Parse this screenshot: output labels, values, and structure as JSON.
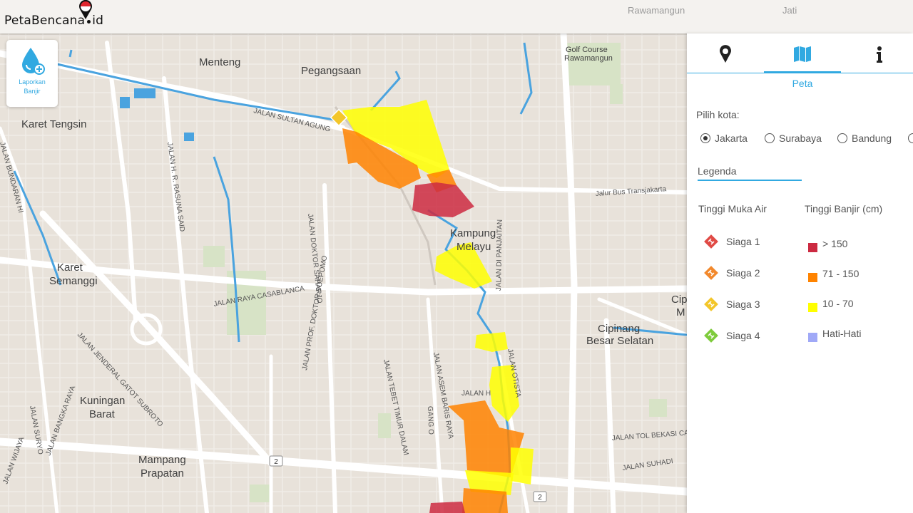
{
  "header": {
    "brand": "PetaBencana",
    "brand_suffix": "id",
    "map_labels_top": [
      "Rawamangun",
      "Jati"
    ]
  },
  "report_button": {
    "line1": "Laporkan",
    "line2": "Banjir",
    "icon": "water-drop-plus-icon"
  },
  "map": {
    "place_labels": [
      "Menteng",
      "Pegangsaan",
      "Karet Tengsin",
      "Karet",
      "Semanggi",
      "Kampung",
      "Melayu",
      "Kuningan",
      "Barat",
      "Mampang",
      "Prapatan",
      "Cipinang",
      "Besar Selatan",
      "Golf Course",
      "Rawamangun",
      "Cip",
      "M"
    ],
    "road_labels": [
      "JALAN SULTAN AGUNG",
      "JALAN H. R. RASUNA SAID",
      "JALAN DOKTOR SAHARJO",
      "JALAN RAYA CASABLANCA",
      "JALAN JENDERAL GATOT SUBROTO",
      "JALAN PROF. DOKTOR SOEPOMO",
      "JALAN TEBET TIMUR DALAM",
      "JALAN ASEM BARIS RAYA",
      "JALAN DI PANJAITAN",
      "JALAN TOL BEKASI CAWANG",
      "JALAN SUHADI",
      "JALAN OTISTA",
      "JALAN BUNDARAN HI",
      "Jalur Bus Transjakarta",
      "JALAN SURYO",
      "JALAN WIJAYA",
      "JALAN BANGKA RAYA",
      "GANG O",
      "JALAN H"
    ],
    "route_badges": [
      "2",
      "2"
    ]
  },
  "panel": {
    "tabs": [
      {
        "name": "tab-report",
        "icon": "map-pin-icon"
      },
      {
        "name": "tab-map",
        "icon": "map-icon",
        "label": "Peta"
      },
      {
        "name": "tab-info",
        "icon": "info-icon"
      }
    ],
    "city_prompt": "Pilih kota:",
    "cities": [
      {
        "label": "Jakarta",
        "selected": true
      },
      {
        "label": "Surabaya",
        "selected": false
      },
      {
        "label": "Bandung",
        "selected": false
      }
    ],
    "legend_title": "Legenda",
    "water_level_title": "Tinggi Muka Air",
    "flood_height_title": "Tinggi Banjir (cm)",
    "water_levels": [
      {
        "label": "Siaga 1",
        "color": "#e04a45"
      },
      {
        "label": "Siaga 2",
        "color": "#f2892d"
      },
      {
        "label": "Siaga 3",
        "color": "#f3c62a"
      },
      {
        "label": "Siaga 4",
        "color": "#7ecb3c"
      }
    ],
    "flood_heights": [
      {
        "label": "> 150",
        "color": "#cc2a41"
      },
      {
        "label": "71 - 150",
        "color": "#ff8300"
      },
      {
        "label": "10 - 70",
        "color": "#ffff00"
      },
      {
        "label": "Hati-Hati",
        "color": "#a0a9f7"
      }
    ]
  },
  "colors": {
    "accent": "#31a9e1",
    "river": "#4aa3df",
    "flood_red": "#cc2a41",
    "flood_orange": "#ff8300",
    "flood_yellow": "#ffff00"
  }
}
